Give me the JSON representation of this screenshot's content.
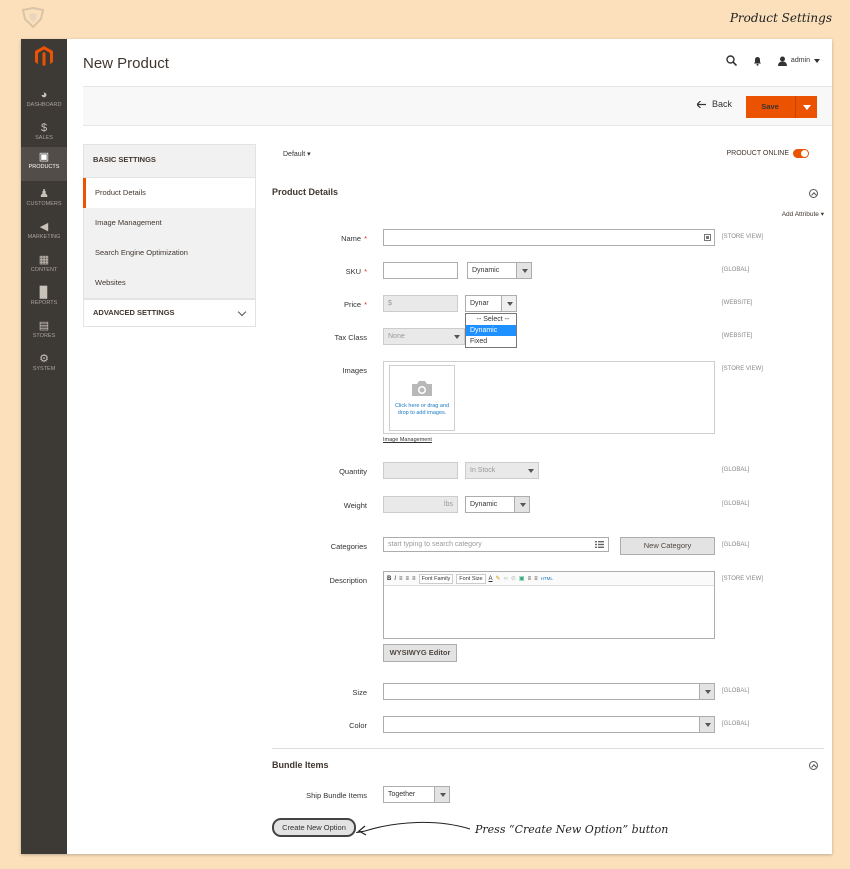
{
  "outer": {
    "title": "Product Settings"
  },
  "sidebar": {
    "items": [
      {
        "label": "DASHBOARD",
        "icon": "dashboard-icon"
      },
      {
        "label": "SALES",
        "icon": "dollar-icon"
      },
      {
        "label": "PRODUCTS",
        "icon": "cube-icon"
      },
      {
        "label": "CUSTOMERS",
        "icon": "person-icon"
      },
      {
        "label": "MARKETING",
        "icon": "megaphone-icon"
      },
      {
        "label": "CONTENT",
        "icon": "layout-icon"
      },
      {
        "label": "REPORTS",
        "icon": "bar-chart-icon"
      },
      {
        "label": "STORES",
        "icon": "store-icon"
      },
      {
        "label": "SYSTEM",
        "icon": "gear-icon"
      }
    ],
    "active": "PRODUCTS"
  },
  "header": {
    "title": "New Product",
    "user": "admin"
  },
  "actions": {
    "back": "Back",
    "save": "Save"
  },
  "tabs": {
    "basic": "BASIC SETTINGS",
    "items": [
      "Product Details",
      "Image Management",
      "Search Engine Optimization",
      "Websites"
    ],
    "advanced": "ADVANCED SETTINGS"
  },
  "form": {
    "scope": "Default",
    "online_label": "PRODUCT ONLINE",
    "section_title": "Product Details",
    "add_attribute": "Add Attribute",
    "name": {
      "label": "Name",
      "scope": "[STORE VIEW]"
    },
    "sku": {
      "label": "SKU",
      "type": "Dynamic",
      "scope": "[GLOBAL]"
    },
    "price": {
      "label": "Price",
      "placeholder": "$",
      "type": "Dynar",
      "scope": "[WEBSITE]",
      "options": [
        "-- Select --",
        "Dynamic",
        "Fixed"
      ],
      "selected": "Dynamic"
    },
    "tax": {
      "label": "Tax Class",
      "value": "None",
      "scope": "[WEBSITE]"
    },
    "images": {
      "label": "Images",
      "hint": "Click here or drag and drop to add images.",
      "link": "Image Management",
      "scope": "[STORE VIEW]"
    },
    "quantity": {
      "label": "Quantity",
      "stock": "In Stock",
      "scope": "[GLOBAL]"
    },
    "weight": {
      "label": "Weight",
      "unit": "lbs",
      "type": "Dynamic",
      "scope": "[GLOBAL]"
    },
    "categories": {
      "label": "Categories",
      "placeholder": "start typing to search category",
      "button": "New Category",
      "scope": "[GLOBAL]"
    },
    "description": {
      "label": "Description",
      "font_family": "Font Family",
      "font_size": "Font Size",
      "editor_button": "WYSIWYG Editor",
      "scope": "[STORE VIEW]"
    },
    "size": {
      "label": "Size",
      "scope": "[GLOBAL]"
    },
    "color": {
      "label": "Color",
      "scope": "[GLOBAL]"
    }
  },
  "bundle": {
    "title": "Bundle Items",
    "ship_label": "Ship Bundle Items",
    "ship_value": "Together",
    "create_button": "Create New Option"
  },
  "annotation": {
    "text": "Press “Create New Option” button"
  },
  "colors": {
    "accent": "#eb5202",
    "sidebar": "#3d3935",
    "background": "#fbe0bb"
  }
}
